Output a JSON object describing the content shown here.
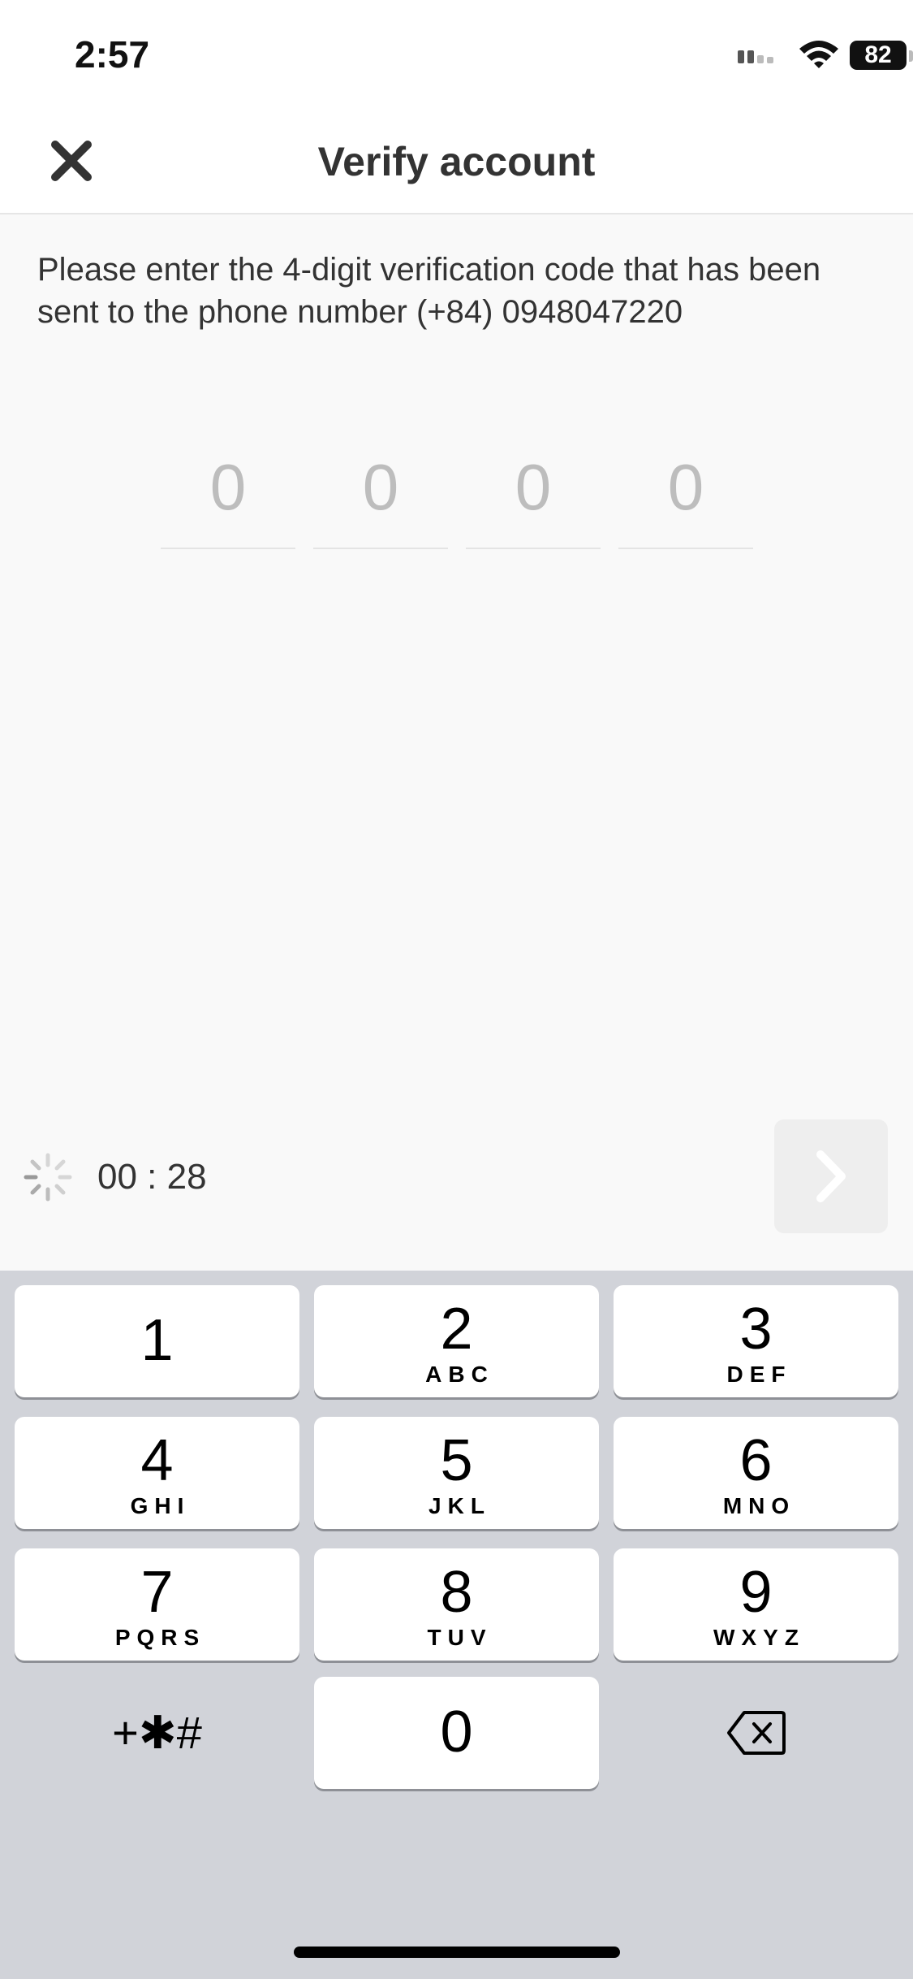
{
  "status_bar": {
    "time": "2:57",
    "battery": "82"
  },
  "header": {
    "title": "Verify account"
  },
  "instructions": "Please enter the 4-digit verification code that has been sent to the phone number (+84) 0948047220",
  "code_inputs": [
    {
      "placeholder": "0",
      "value": ""
    },
    {
      "placeholder": "0",
      "value": ""
    },
    {
      "placeholder": "0",
      "value": ""
    },
    {
      "placeholder": "0",
      "value": ""
    }
  ],
  "timer": {
    "text": "00 : 28"
  },
  "keypad": {
    "keys": [
      {
        "digit": "1",
        "letters": ""
      },
      {
        "digit": "2",
        "letters": "ABC"
      },
      {
        "digit": "3",
        "letters": "DEF"
      },
      {
        "digit": "4",
        "letters": "GHI"
      },
      {
        "digit": "5",
        "letters": "JKL"
      },
      {
        "digit": "6",
        "letters": "MNO"
      },
      {
        "digit": "7",
        "letters": "PQRS"
      },
      {
        "digit": "8",
        "letters": "TUV"
      },
      {
        "digit": "9",
        "letters": "WXYZ"
      }
    ],
    "symbols": "+✱#",
    "zero": "0"
  },
  "colors": {
    "keyboard_bg": "#d1d3d9",
    "next_button_bg": "#eeeeee",
    "placeholder": "#bdbdbd"
  }
}
